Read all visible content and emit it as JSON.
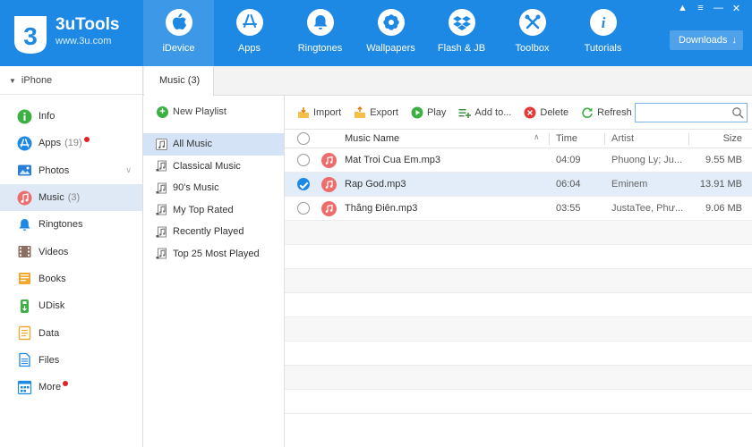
{
  "brand": {
    "name": "3uTools",
    "url": "www.3u.com"
  },
  "header": {
    "nav": [
      {
        "label": "iDevice",
        "icon": "apple-icon",
        "active": true
      },
      {
        "label": "Apps",
        "icon": "app-store-icon",
        "active": false
      },
      {
        "label": "Ringtones",
        "icon": "bell-icon",
        "active": false
      },
      {
        "label": "Wallpapers",
        "icon": "flower-icon",
        "active": false
      },
      {
        "label": "Flash & JB",
        "icon": "dropbox-icon",
        "active": false
      },
      {
        "label": "Toolbox",
        "icon": "tools-icon",
        "active": false
      },
      {
        "label": "Tutorials",
        "icon": "info-icon",
        "active": false
      }
    ],
    "downloads_label": "Downloads"
  },
  "sidebar": {
    "device": "iPhone",
    "items": [
      {
        "label": "Info",
        "count": "",
        "icon": "info-icon",
        "color": "#3cb043",
        "dot": false,
        "active": false
      },
      {
        "label": "Apps",
        "count": "(19)",
        "icon": "apps-icon",
        "color": "#1e88e5",
        "dot": true,
        "active": false
      },
      {
        "label": "Photos",
        "count": "",
        "icon": "photos-icon",
        "color": "#2a7fd4",
        "dot": false,
        "active": false,
        "chevron": true
      },
      {
        "label": "Music",
        "count": "(3)",
        "icon": "music-icon",
        "color": "#ef6c6c",
        "dot": false,
        "active": true
      },
      {
        "label": "Ringtones",
        "count": "",
        "icon": "bell-icon",
        "color": "#1e88e5",
        "dot": false,
        "active": false
      },
      {
        "label": "Videos",
        "count": "",
        "icon": "videos-icon",
        "color": "#8d6e63",
        "dot": false,
        "active": false
      },
      {
        "label": "Books",
        "count": "",
        "icon": "books-icon",
        "color": "#f0a830",
        "dot": false,
        "active": false
      },
      {
        "label": "UDisk",
        "count": "",
        "icon": "udisk-icon",
        "color": "#3cb043",
        "dot": false,
        "active": false
      },
      {
        "label": "Data",
        "count": "",
        "icon": "data-icon",
        "color": "#f0a830",
        "dot": false,
        "active": false
      },
      {
        "label": "Files",
        "count": "",
        "icon": "files-icon",
        "color": "#1e88e5",
        "dot": false,
        "active": false
      },
      {
        "label": "More",
        "count": "",
        "icon": "more-icon",
        "color": "#1e88e5",
        "dot": true,
        "active": false
      }
    ]
  },
  "tabs": [
    {
      "label": "Music (3)"
    }
  ],
  "playlists": {
    "new_label": "New Playlist",
    "items": [
      {
        "label": "All Music",
        "active": true
      },
      {
        "label": "Classical Music",
        "active": false
      },
      {
        "label": "90's Music",
        "active": false
      },
      {
        "label": "My Top Rated",
        "active": false
      },
      {
        "label": "Recently Played",
        "active": false
      },
      {
        "label": "Top 25 Most Played",
        "active": false
      }
    ]
  },
  "toolbar": {
    "import": "Import",
    "export": "Export",
    "play": "Play",
    "add_to": "Add to...",
    "delete": "Delete",
    "refresh": "Refresh",
    "search_placeholder": ""
  },
  "table": {
    "headers": {
      "name": "Music Name",
      "time": "Time",
      "artist": "Artist",
      "size": "Size"
    },
    "rows": [
      {
        "name": "Mat Troi Cua Em.mp3",
        "time": "04:09",
        "artist": "Phuong Ly; Ju...",
        "size": "9.55 MB",
        "checked": false
      },
      {
        "name": "Rap God.mp3",
        "time": "06:04",
        "artist": "Eminem",
        "size": "13.91 MB",
        "checked": true
      },
      {
        "name": "Thằng Điên.mp3",
        "time": "03:55",
        "artist": "JustaTee, Phư...",
        "size": "9.06 MB",
        "checked": false
      }
    ]
  }
}
